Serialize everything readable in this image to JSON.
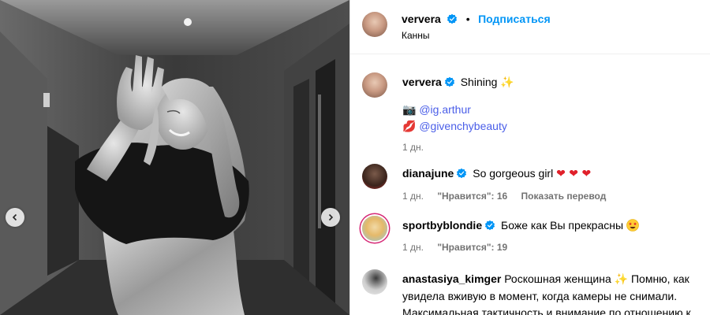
{
  "post": {
    "username": "ververa",
    "follow_label": "Подписаться",
    "location": "Канны"
  },
  "caption": {
    "username": "ververa",
    "text": "Shining",
    "sparkle": "✨",
    "line1_icon": "📷",
    "line1_mention": "@ig.arthur",
    "line2_icon": "💋",
    "line2_mention": "@givenchybeauty",
    "time": "1 дн."
  },
  "comments": [
    {
      "username": "dianajune",
      "text": "So gorgeous girl",
      "hearts": "❤ ❤ ❤",
      "time": "1 дн.",
      "likes": "\"Нравится\": 16",
      "translate": "Показать перевод"
    },
    {
      "username": "sportbyblondie",
      "text": "Боже как Вы прекрасны",
      "time": "1 дн.",
      "likes": "\"Нравится\": 19"
    },
    {
      "username": "anastasiya_kimger",
      "text_before": "Роскошная женщина",
      "sparkle": "✨",
      "text_after": "Помню, как увидела вживую в момент, когда камеры не снимали. Максимальная тактичность и внимание по отношению к"
    }
  ],
  "icons": {
    "verified": "verified-badge-icon",
    "prev": "chevron-left-icon",
    "next": "chevron-right-icon"
  },
  "colors": {
    "link_blue": "#0095f6",
    "verified_blue": "#0095f6",
    "muted": "#737373"
  }
}
